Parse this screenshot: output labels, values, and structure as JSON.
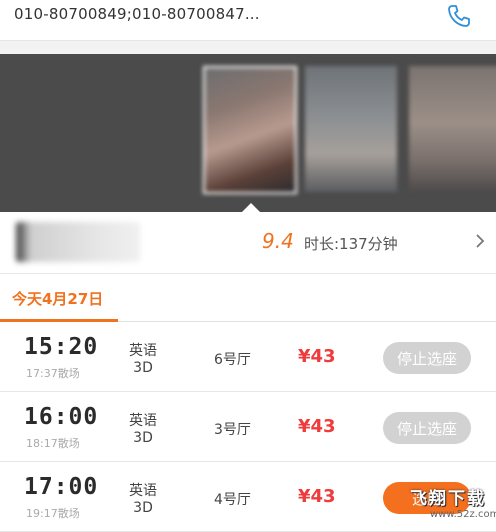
{
  "cinema": {
    "phone": "010-80700849;010-80700847...",
    "phone_icon": "phone-icon"
  },
  "movie": {
    "score": "9.4",
    "duration": "时长:137分钟",
    "chevron_icon": "chevron-right-icon"
  },
  "date_tab": {
    "label": "今天4月27日"
  },
  "showtimes": [
    {
      "time": "15:20",
      "end": "17:37散场",
      "lang": "英语",
      "format": "3D",
      "hall": "6号厅",
      "price": "¥43",
      "button": "停止选座",
      "button_state": "disabled"
    },
    {
      "time": "16:00",
      "end": "18:17散场",
      "lang": "英语",
      "format": "3D",
      "hall": "3号厅",
      "price": "¥43",
      "button": "停止选座",
      "button_state": "disabled"
    },
    {
      "time": "17:00",
      "end": "19:17散场",
      "lang": "英语",
      "format": "3D",
      "hall": "4号厅",
      "price": "¥43",
      "button": "选座",
      "button_state": "active"
    }
  ],
  "watermark": {
    "text": "飞翔下载",
    "sub": "www.52z.com"
  },
  "colors": {
    "accent": "#f0711e",
    "price": "#ef3b3b",
    "disabled_button": "#d2d2d2",
    "phone_icon": "#2f8fd8"
  }
}
